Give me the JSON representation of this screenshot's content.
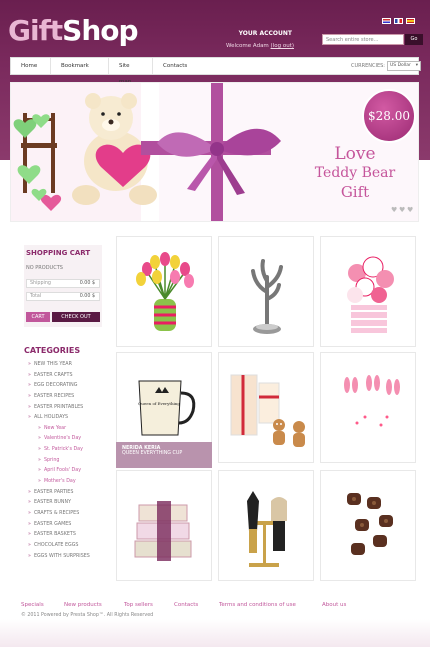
{
  "header": {
    "logo_part1": "Gift",
    "logo_part2": "Shop",
    "account_title": "YOUR ACCOUNT",
    "welcome": "Welcome Adam",
    "logout": "(log out)",
    "search_placeholder": "Search entire store...",
    "search_button": "Go"
  },
  "nav": {
    "items": [
      "Home",
      "Bookmark",
      "Site map",
      "Contacts"
    ],
    "currencies_label": "CURRENCIES:",
    "currency_value": "US Dollar"
  },
  "banner": {
    "price": "$28.00",
    "line1": "Love",
    "line2": "Teddy Bear",
    "line3": "Gift",
    "dots": [
      "♥",
      "♥",
      "♥"
    ]
  },
  "cart": {
    "title": "SHOPPING CART",
    "empty": "NO PRODUCTS",
    "shipping_label": "Shipping",
    "shipping_value": "0.00 $",
    "total_label": "Total",
    "total_value": "0.00 $",
    "cart_button": "CART",
    "checkout_button": "CHECK OUT"
  },
  "categories": {
    "title": "CATEGORIES",
    "items": [
      {
        "label": "NEW THIS YEAR",
        "sub": false
      },
      {
        "label": "EASTER CRAFTS",
        "sub": false
      },
      {
        "label": "EGG DECORATING",
        "sub": false
      },
      {
        "label": "EASTER RECIPES",
        "sub": false
      },
      {
        "label": "EASTER PRINTABLES",
        "sub": false
      },
      {
        "label": "ALL HOLIDAYS",
        "sub": false
      },
      {
        "label": "New Year",
        "sub": true
      },
      {
        "label": "Valentine's Day",
        "sub": true
      },
      {
        "label": "St. Patrick's Day",
        "sub": true
      },
      {
        "label": "Spring",
        "sub": true
      },
      {
        "label": "April Fools' Day",
        "sub": true
      },
      {
        "label": "Mother's Day",
        "sub": true
      },
      {
        "label": "EASTER PARTIES",
        "sub": false
      },
      {
        "label": "EASTER BUNNY",
        "sub": false
      },
      {
        "label": "CRAFTS & RECIPES",
        "sub": false
      },
      {
        "label": "EASTER GAMES",
        "sub": false
      },
      {
        "label": "EASTER BASKETS",
        "sub": false
      },
      {
        "label": "CHOCOLATE EGGS",
        "sub": false
      },
      {
        "label": "EGGS WITH SURPRISES",
        "sub": false
      }
    ]
  },
  "featured": {
    "name": "NERIDA KERIA",
    "desc": "QUEEN EVERYTHING CUP"
  },
  "products": {
    "mug_text": "Queen of Everything"
  },
  "footer": {
    "links": [
      "Specials",
      "New products",
      "Top sellers",
      "Contacts",
      "Terms and conditions of use",
      "About us"
    ],
    "copyright": "© 2011 Powered by Presta Shop™. All Rights Reserved"
  },
  "colors": {
    "brand": "#8b2a6b",
    "header": "#7a2a5d",
    "link": "#c1579b"
  }
}
